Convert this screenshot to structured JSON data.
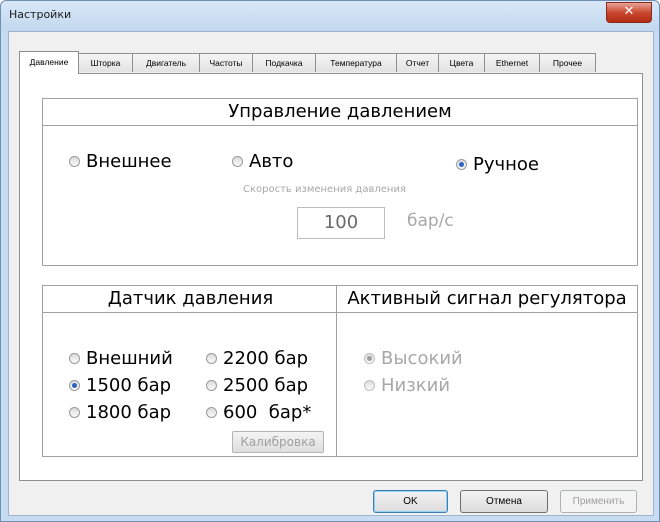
{
  "window": {
    "title": "Настройки",
    "close_glyph": "✕"
  },
  "tabs": [
    {
      "label": "Давление",
      "active": true
    },
    {
      "label": "Шторка"
    },
    {
      "label": "Двигатель"
    },
    {
      "label": "Частоты"
    },
    {
      "label": "Подкачка"
    },
    {
      "label": "Температура"
    },
    {
      "label": "Отчет"
    },
    {
      "label": "Цвета"
    },
    {
      "label": "Ethernet"
    },
    {
      "label": "Прочее"
    }
  ],
  "pressure_control": {
    "title": "Управление давлением",
    "options": [
      {
        "label": "Внешнее",
        "selected": false
      },
      {
        "label": "Авто",
        "selected": false
      },
      {
        "label": "Ручное",
        "selected": true
      }
    ],
    "rate_label": "Скорость изменения давления",
    "rate_value": "100",
    "rate_unit": "бар/с"
  },
  "sensor": {
    "title": "Датчик давления",
    "options": [
      {
        "label": "Внешний",
        "selected": false
      },
      {
        "label": "2200 бар",
        "selected": false
      },
      {
        "label": "1500 бар",
        "selected": true
      },
      {
        "label": "2500 бар",
        "selected": false
      },
      {
        "label": "1800 бар",
        "selected": false
      },
      {
        "label": "600  бар*",
        "selected": false
      }
    ],
    "calibrate_label": "Калибровка"
  },
  "regulator_signal": {
    "title": "Активный сигнал регулятора",
    "options": [
      {
        "label": "Высокий",
        "selected": true,
        "disabled": true
      },
      {
        "label": "Низкий",
        "selected": false,
        "disabled": true
      }
    ]
  },
  "buttons": {
    "ok": "OK",
    "cancel": "Отмена",
    "apply": "Применить"
  },
  "colors": {
    "selection_dot": "#2a63c0",
    "disabled_text": "#a8a8a8",
    "frame": "#c8dcf1"
  }
}
